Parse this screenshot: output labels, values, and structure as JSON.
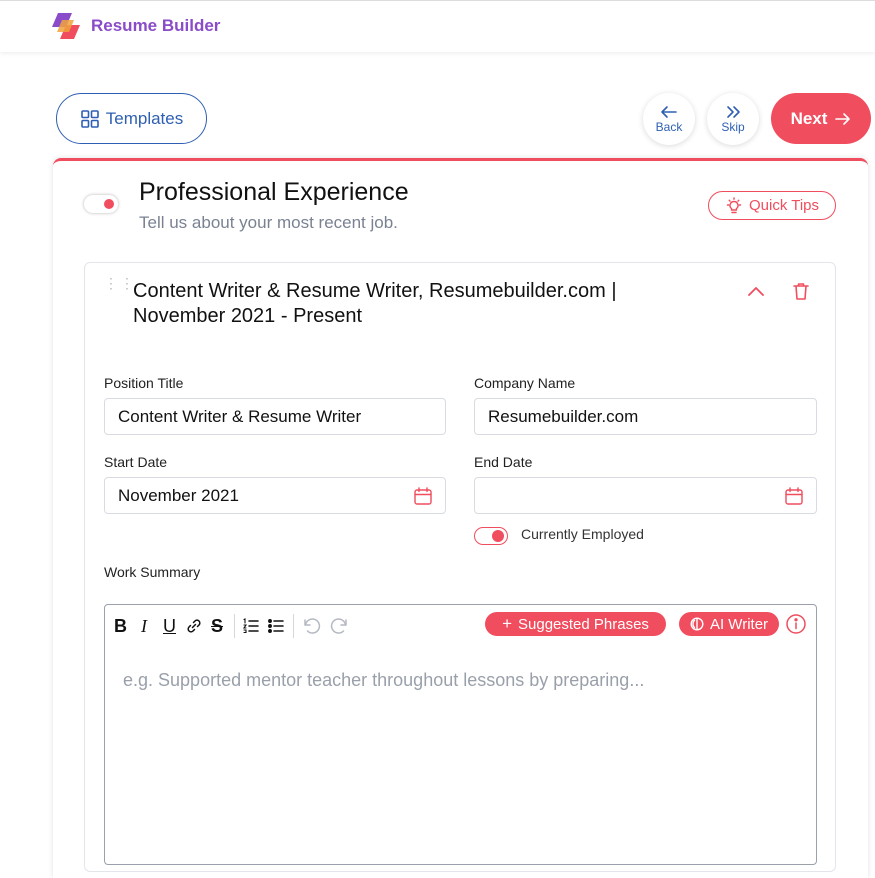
{
  "app": {
    "brand": "Resume Builder"
  },
  "nav": {
    "templates_label": "Templates",
    "back_label": "Back",
    "skip_label": "Skip",
    "next_label": "Next"
  },
  "section": {
    "title": "Professional Experience",
    "subtitle": "Tell us about your most recent job.",
    "tips_label": "Quick Tips"
  },
  "entry": {
    "title": "Content Writer & Resume Writer, Resumebuilder.com | November 2021 - Present",
    "position_label": "Position Title",
    "position_value": "Content Writer & Resume Writer",
    "company_label": "Company Name",
    "company_value": "Resumebuilder.com",
    "start_label": "Start Date",
    "start_value": "November 2021",
    "end_label": "End Date",
    "end_value": "",
    "employed_label": "Currently Employed",
    "summary_label": "Work Summary"
  },
  "editor": {
    "bold": "B",
    "italic": "I",
    "underline": "U",
    "strike": "S",
    "suggested_label": "Suggested Phrases",
    "ai_label": "AI Writer",
    "placeholder": "e.g. Supported mentor teacher throughout lessons by preparing..."
  },
  "colors": {
    "accent": "#f04d5e",
    "primary_blue": "#2f5fb3",
    "brand_purple": "#8a4cc8"
  }
}
